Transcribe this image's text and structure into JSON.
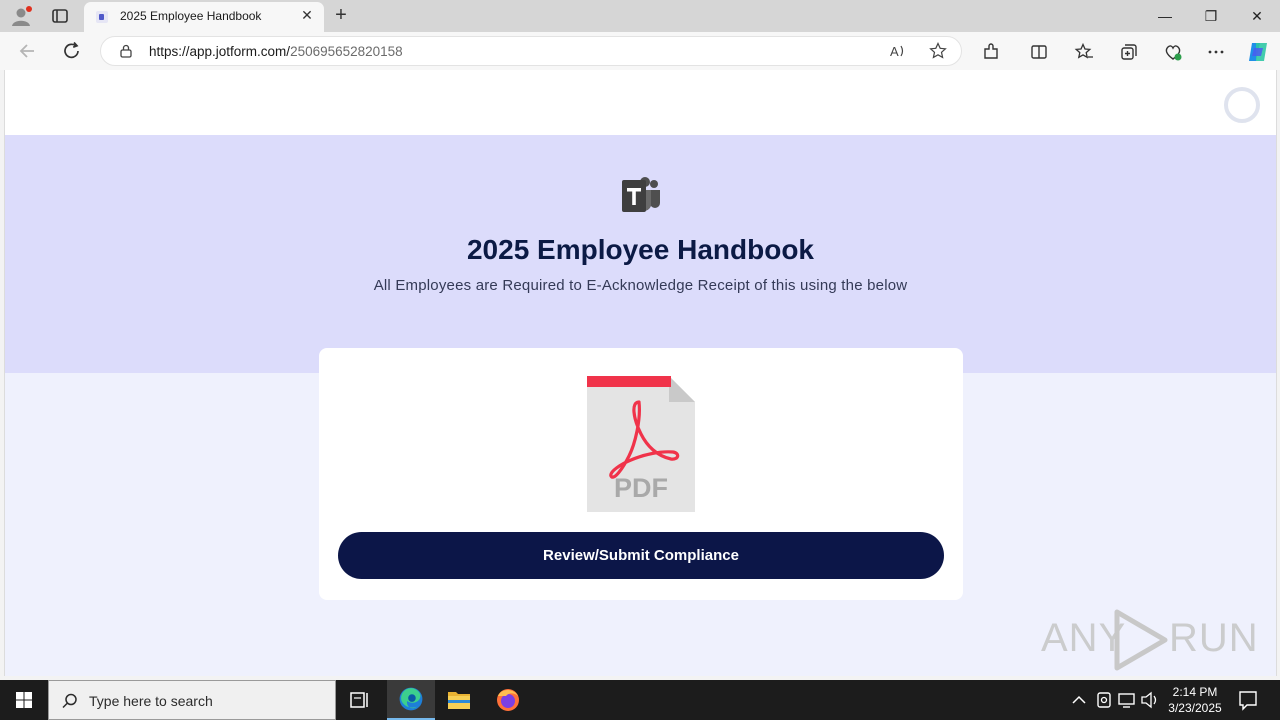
{
  "browser": {
    "tab_title": "2025 Employee Handbook",
    "url_host": "https://app.jotform.com/",
    "url_path": "250695652820158",
    "window_controls": {
      "minimize": "—",
      "restore": "❐",
      "close": "✕"
    },
    "tab_close": "✕",
    "new_tab": "+"
  },
  "page": {
    "heading": "2025 Employee Handbook",
    "subheading": "All Employees are Required to E-Acknowledge Receipt of this using the below",
    "pdf_label": "PDF",
    "cta_label": "Review/Submit Compliance"
  },
  "watermark": {
    "text_left": "ANY",
    "text_right": "RUN"
  },
  "taskbar": {
    "search_placeholder": "Type here to search",
    "time": "2:14 PM",
    "date": "3/23/2025"
  },
  "colors": {
    "hero_bg": "#dcdcfb",
    "page_bg": "#eff1fd",
    "cta_bg": "#0c1648",
    "heading": "#0b1a45",
    "pdf_red": "#f0334a"
  },
  "icons": [
    "profile-icon",
    "tab-actions-icon",
    "teams-favicon-icon",
    "back-icon",
    "refresh-icon",
    "lock-icon",
    "read-aloud-icon",
    "favorite-star-icon",
    "extensions-icon",
    "split-screen-icon",
    "favorites-icon",
    "collections-icon",
    "browser-essentials-icon",
    "more-icon",
    "copilot-icon",
    "loader-icon",
    "teams-logo-icon",
    "pdf-file-icon",
    "windows-start-icon",
    "search-icon",
    "task-view-icon",
    "edge-icon",
    "file-explorer-icon",
    "firefox-icon",
    "chevron-up-icon",
    "meet-now-icon",
    "network-icon",
    "volume-icon",
    "notifications-icon"
  ]
}
